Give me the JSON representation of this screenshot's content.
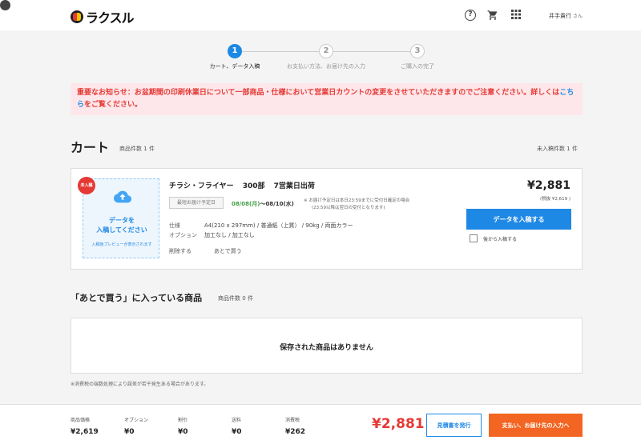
{
  "header": {
    "logo_text": "ラクスル",
    "help_icon": "help-circle-icon",
    "cart_icon": "cart-icon",
    "apps_icon": "apps-grid-icon",
    "user_icon": "account-icon",
    "user_name": "井手貴行",
    "user_suffix": "さん"
  },
  "stepper": {
    "steps": [
      {
        "number": "1",
        "label": "カート、データ入稿",
        "active": true
      },
      {
        "number": "2",
        "label": "お支払い方法、お届け先の入力",
        "active": false
      },
      {
        "number": "3",
        "label": "ご購入の完了",
        "active": false
      }
    ]
  },
  "notice": {
    "text": "重要なお知らせ：お盆期間の印刷休業日について一部商品・仕様において営業日カウントの変更をさせていただきますのでご注意ください。詳しくは",
    "link_text": "こちら",
    "text_after": "をご覧ください。"
  },
  "cart": {
    "title": "カート",
    "item_count_label": "商品件数",
    "item_count": "1",
    "count_unit": "件",
    "unsubmitted_label": "未入稿件数",
    "unsubmitted_count": "1",
    "unsubmitted_unit": "件"
  },
  "item": {
    "badge": "未入稿",
    "upload_title_1": "データを",
    "upload_title_2": "入稿してください",
    "upload_sub": "入稿後プレビューが表示されます",
    "product": "チラシ・フライヤー",
    "quantity": "300部",
    "lead_time": "7営業日出荷",
    "ship_chip": "最短お届け予定日",
    "ship_from": "08/08(月)",
    "ship_sep": "〜",
    "ship_to": "08/10(水)",
    "ship_note_1": "※ お届け予定日は本日23:59までに受付日確定の場合",
    "ship_note_2": "(23:59以降は翌日の受付となります)",
    "spec_label": "仕様",
    "spec_value": "A4(210 x 297mm) / 普通紙（上質） / 90kg / 両面カラー",
    "option_label": "オプション",
    "option_value": "加工なし / 加工なし",
    "delete": "削除する",
    "buy_later": "あとで買う",
    "price": "¥2,881",
    "price_tax": "(税抜 ¥2,619 )",
    "submit_button": "データを入稿する",
    "later_upload": "後から入稿する",
    "later_checked": false
  },
  "saved": {
    "title": "「あとで買う」に入っている商品",
    "count_label": "商品件数",
    "count": "0",
    "unit": "件",
    "empty": "保存された商品はありません"
  },
  "tax_note": "※消費税の端数処理により誤差が若干発生ある場合があります。",
  "footer": {
    "items": [
      {
        "label": "商品価格",
        "value": "¥2,619"
      },
      {
        "label": "オプション",
        "value": "¥0"
      },
      {
        "label": "割引",
        "value": "¥0"
      },
      {
        "label": "送料",
        "value": "¥0"
      },
      {
        "label": "消費税",
        "value": "¥262"
      }
    ],
    "total": "¥2,881",
    "quote_button": "見積書を発行",
    "pay_button": "支払い、お届け先の入力へ"
  },
  "colors": {
    "primary": "#1e88e5",
    "danger": "#e53935",
    "accent_orange": "#f26522",
    "green": "#43a047"
  }
}
